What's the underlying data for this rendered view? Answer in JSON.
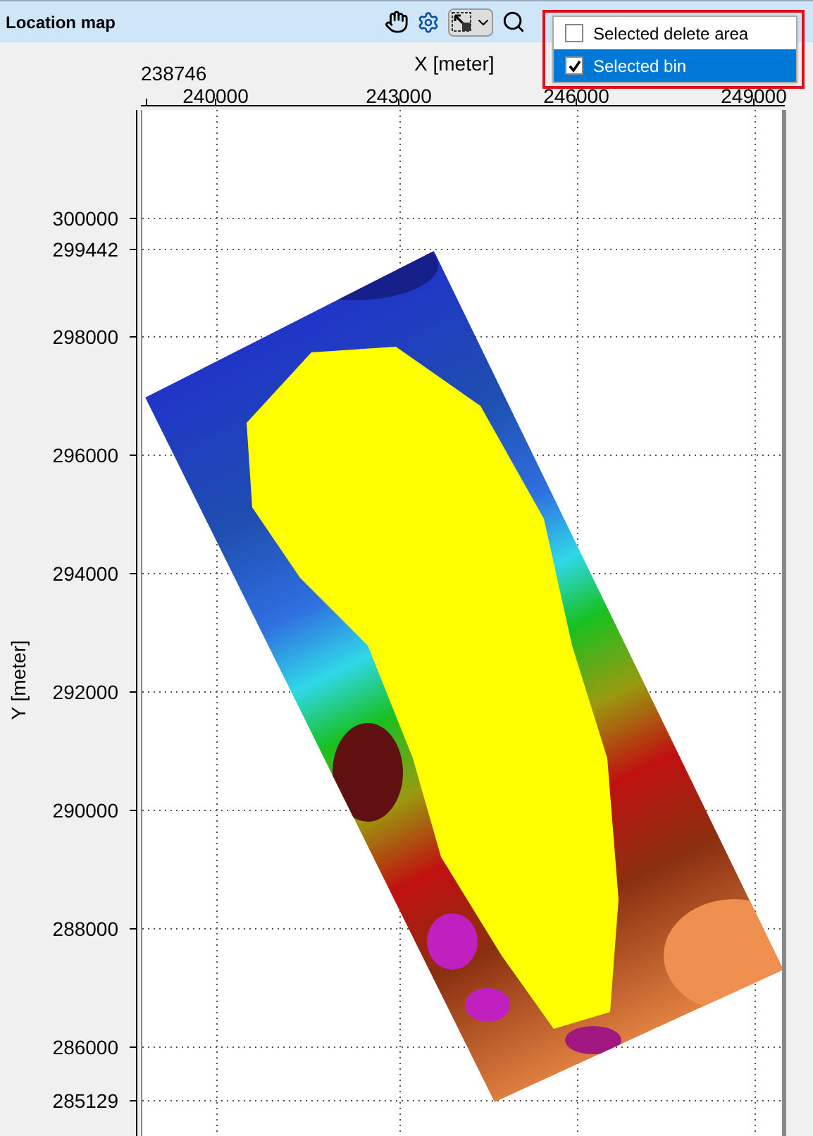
{
  "panel": {
    "title": "Location map"
  },
  "menu": {
    "items": [
      {
        "label": "Selected delete area",
        "checked": false,
        "selected": false
      },
      {
        "label": "Selected bin",
        "checked": true,
        "selected": true
      }
    ]
  },
  "x_axis": {
    "title": "X [meter]",
    "ticks": [
      "238746",
      "240000",
      "243000",
      "246000",
      "249000"
    ]
  },
  "y_axis": {
    "title": "Y [meter]",
    "ticks": [
      "300000",
      "299442",
      "298000",
      "296000",
      "294000",
      "292000",
      "290000",
      "288000",
      "286000",
      "285129"
    ]
  }
}
